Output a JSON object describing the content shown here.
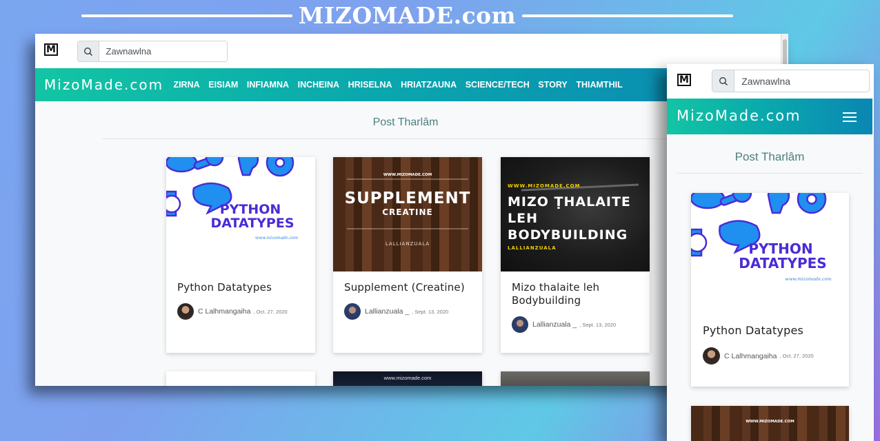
{
  "banner": {
    "title": "MIZOMADE.com"
  },
  "site": {
    "logo_letter": "M",
    "search_placeholder": "Zawnawlna",
    "brand": "MizoMade.com",
    "menu": [
      "ZIRNA",
      "EISIAM",
      "INFIAMNA",
      "INCHEINA",
      "HRISELNA",
      "HRIATZAUNA",
      "SCIENCE/TECH",
      "STORY",
      "THIAMTHIL"
    ],
    "section_title": "Post Tharlâm"
  },
  "posts": [
    {
      "title": "Python Datatypes",
      "author": "C Lalhmangaiha",
      "date": ", Oct. 27, 2020",
      "thumb": {
        "line1": "PYTHON",
        "line2": "DATATYPES",
        "site": "www.mizomade.com"
      }
    },
    {
      "title": "Supplement (Creatine)",
      "author": "Lallianzuala _",
      "date": ", Sept. 13, 2020",
      "thumb": {
        "site": "WWW.MIZOMADE.COM",
        "line1": "SUPPLEMENT",
        "line2": "CREATINE",
        "byline": "LALLIANZUALA"
      }
    },
    {
      "title_line1": "Mizo thalaite leh",
      "title_line2": "Bodybuilding",
      "author": "Lallianzuala _",
      "date": ", Sept. 13, 2020",
      "thumb": {
        "site": "WWW.MIZOMADE.COM",
        "line1": "MIZO ṬHALAITE",
        "line2": "LEH",
        "line3": "BODYBUILDING",
        "byline": "LALLIANZUALA"
      }
    }
  ],
  "row2": {
    "site": "www.mizomade.com"
  },
  "colors": {
    "accent_start": "#12c5a4",
    "accent_end": "#0a86b3",
    "python_text": "#4b2bd6",
    "bulb_blue": "#1f8ff0"
  }
}
